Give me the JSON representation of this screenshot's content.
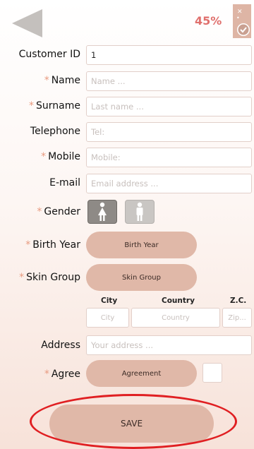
{
  "header": {
    "progress": "45%",
    "progress_value": 0.45,
    "back_icon": "back-arrow-icon",
    "status_icon": "form-status-icon"
  },
  "form": {
    "customer_id": {
      "label": "Customer ID",
      "value": "1",
      "required": false
    },
    "name": {
      "label": "Name",
      "placeholder": "Name ...",
      "required": true
    },
    "surname": {
      "label": "Surname",
      "placeholder": "Last name ...",
      "required": true
    },
    "telephone": {
      "label": "Telephone",
      "placeholder": "Tel:",
      "required": false
    },
    "mobile": {
      "label": "Mobile",
      "placeholder": "Mobile:",
      "required": true
    },
    "email": {
      "label": "E-mail",
      "placeholder": "Email address ...",
      "required": false
    },
    "gender": {
      "label": "Gender",
      "required": true,
      "selected": "female",
      "options": [
        "female",
        "male"
      ]
    },
    "birth_year": {
      "label": "Birth Year",
      "button": "Birth Year",
      "required": true
    },
    "skin_group": {
      "label": "Skin Group",
      "button": "Skin Group",
      "required": true
    },
    "location": {
      "city_header": "City",
      "city_placeholder": "City",
      "country_header": "Country",
      "country_placeholder": "Country",
      "zip_header": "Z.C.",
      "zip_placeholder": "Zip..."
    },
    "address": {
      "label": "Address",
      "placeholder": "Your address ...",
      "required": false
    },
    "agree": {
      "label": "Agree",
      "button": "Agreement",
      "required": true,
      "checked": false
    },
    "required_marker": "*"
  },
  "actions": {
    "save_label": "SAVE"
  },
  "colors": {
    "accent": "#e0b8a8",
    "progress_text": "#e0706d",
    "required_marker": "#e89a7f",
    "annotation_ring": "#e01f22"
  }
}
